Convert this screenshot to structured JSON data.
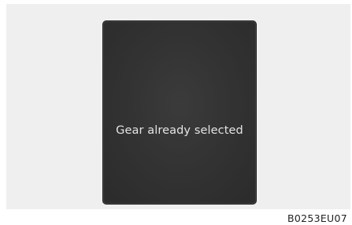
{
  "display": {
    "message": "Gear already selected"
  },
  "figure": {
    "code": "B0253EU07"
  },
  "colors": {
    "background_panel": "#efefef",
    "screen_background": "#333333",
    "message_text": "#e4e4e4"
  }
}
